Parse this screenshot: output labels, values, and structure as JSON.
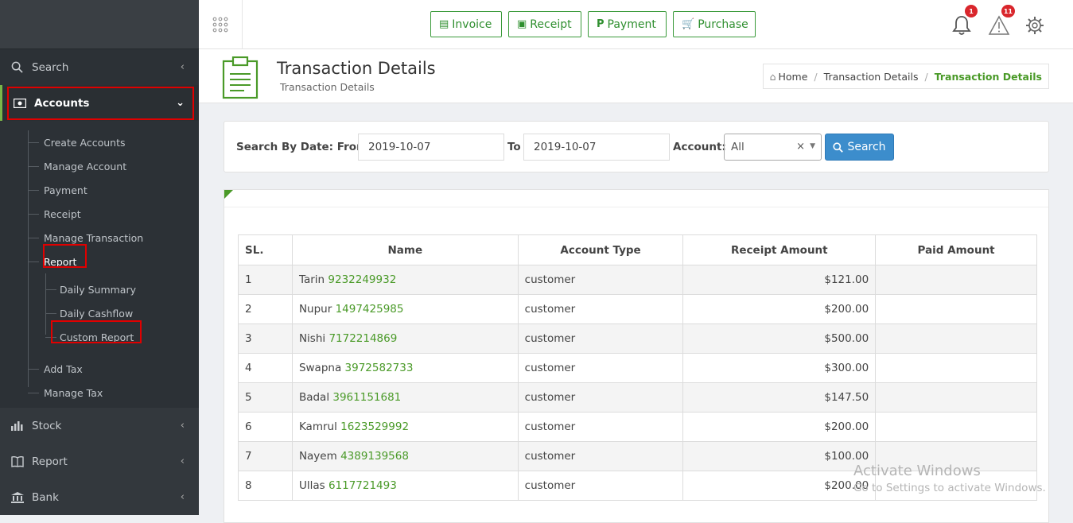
{
  "sidebar": {
    "search": "Search",
    "accounts": "Accounts",
    "sub": [
      "Create Accounts",
      "Manage Account",
      "Payment",
      "Receipt",
      "Manage Transaction",
      "Report"
    ],
    "report_sub": [
      "Daily Summary",
      "Daily Cashflow",
      "Custom Report"
    ],
    "sub2": [
      "Add Tax",
      "Manage Tax"
    ],
    "stock": "Stock",
    "report": "Report",
    "bank": "Bank"
  },
  "topbar": {
    "invoice": "Invoice",
    "receipt": "Receipt",
    "payment": "Payment",
    "purchase": "Purchase",
    "notif_count": "1",
    "alert_count": "11"
  },
  "page": {
    "title": "Transaction Details",
    "subtitle": "Transaction Details",
    "crumb_home": "Home",
    "crumb_1": "Transaction Details",
    "crumb_2": "Transaction Details"
  },
  "search": {
    "label_from": "Search By Date: From",
    "from": "2019-10-07",
    "label_to": "To",
    "to": "2019-10-07",
    "label_account": "Account:",
    "account": "All",
    "clear": "×",
    "button": "Search"
  },
  "table": {
    "headers": [
      "SL.",
      "Name",
      "Account Type",
      "Receipt Amount",
      "Paid Amount"
    ],
    "rows": [
      {
        "sl": "1",
        "name": "Tarin",
        "phone": "9232249932",
        "type": "customer",
        "receipt": "$121.00",
        "paid": ""
      },
      {
        "sl": "2",
        "name": "Nupur",
        "phone": "1497425985",
        "type": "customer",
        "receipt": "$200.00",
        "paid": ""
      },
      {
        "sl": "3",
        "name": "Nishi",
        "phone": "7172214869",
        "type": "customer",
        "receipt": "$500.00",
        "paid": ""
      },
      {
        "sl": "4",
        "name": "Swapna",
        "phone": "3972582733",
        "type": "customer",
        "receipt": "$300.00",
        "paid": ""
      },
      {
        "sl": "5",
        "name": "Badal",
        "phone": "3961151681",
        "type": "customer",
        "receipt": "$147.50",
        "paid": ""
      },
      {
        "sl": "6",
        "name": "Kamrul",
        "phone": "1623529992",
        "type": "customer",
        "receipt": "$200.00",
        "paid": ""
      },
      {
        "sl": "7",
        "name": "Nayem",
        "phone": "4389139568",
        "type": "customer",
        "receipt": "$100.00",
        "paid": ""
      },
      {
        "sl": "8",
        "name": "Ullas",
        "phone": "6117721493",
        "type": "customer",
        "receipt": "$200.00",
        "paid": ""
      }
    ]
  },
  "watermark": {
    "line1": "Activate Windows",
    "line2": "Go to Settings to activate Windows."
  }
}
